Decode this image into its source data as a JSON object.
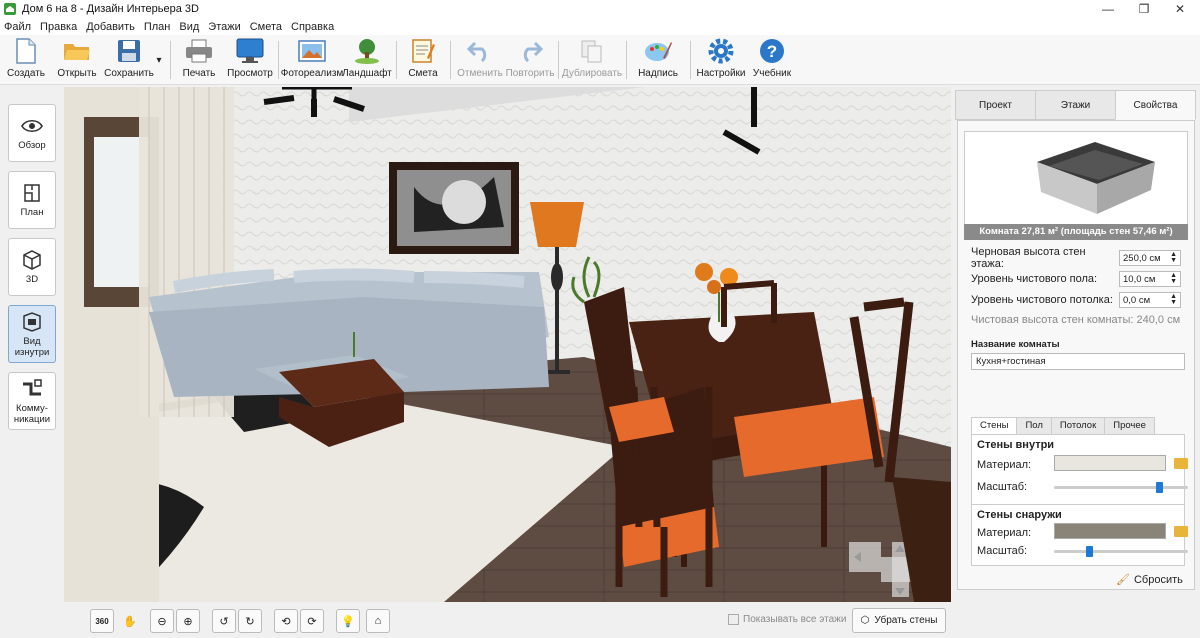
{
  "window": {
    "title": "Дом 6 на 8 - Дизайн Интерьера 3D",
    "controls": [
      "—",
      "❐",
      "✕"
    ]
  },
  "menu": [
    "Файл",
    "Правка",
    "Добавить",
    "План",
    "Вид",
    "Этажи",
    "Смета",
    "Справка"
  ],
  "toolbar": {
    "create": "Создать",
    "open": "Открыть",
    "save": "Сохранить",
    "print": "Печать",
    "preview": "Просмотр",
    "photo": "Фотореализм",
    "landscape": "Ландшафт",
    "estimate": "Смета",
    "undo": "Отменить",
    "redo": "Повторить",
    "duplicate": "Дублировать",
    "caption": "Надпись",
    "settings": "Настройки",
    "tutorial": "Учебник"
  },
  "left_nav": {
    "overview": "Обзор",
    "plan": "План",
    "view3d": "3D",
    "inside": "Вид изнутри",
    "comms": "Комму-никации"
  },
  "bottom": {
    "show_all_floors": "Показывать все этажи",
    "remove_walls": "Убрать стены"
  },
  "panel": {
    "tabs": [
      "Проект",
      "Этажи",
      "Свойства"
    ],
    "room_caption": "Комната 27,81 м²  (площадь стен 57,46 м²)",
    "rough_height_label": "Черновая высота стен этажа:",
    "rough_height": "250,0 см",
    "floor_label": "Уровень чистового пола:",
    "floor": "10,0 см",
    "ceiling_label": "Уровень чистового потолка:",
    "ceiling": "0,0 см",
    "clean_height": "Чистовая высота стен комнаты: 240,0 см",
    "room_name_label": "Название комнаты",
    "room_name": "Кухня+гостиная",
    "subtabs": [
      "Стены",
      "Пол",
      "Потолок",
      "Прочее"
    ],
    "walls_inside": "Стены внутри",
    "walls_outside": "Стены снаружи",
    "material_label": "Материал:",
    "scale_label": "Масштаб:",
    "reset": "Сбросить",
    "inside_scale": 0.8,
    "outside_scale": 0.25
  }
}
